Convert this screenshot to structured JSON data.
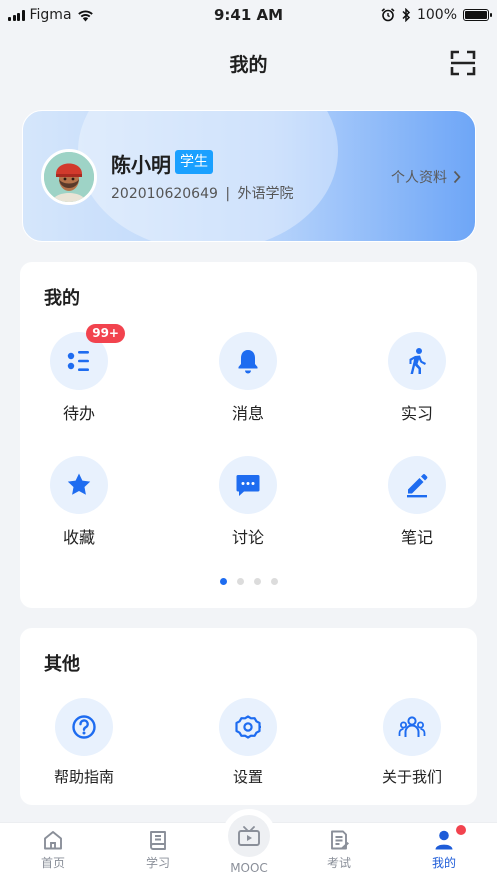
{
  "status_bar": {
    "carrier": "Figma",
    "time": "9:41 AM",
    "battery": "100%",
    "battery_level": 1.0
  },
  "nav": {
    "title": "我的"
  },
  "profile": {
    "name": "陈小明",
    "role": "学生",
    "student_id": "202010620649",
    "separator": "|",
    "college": "外语学院",
    "link_label": "个人资料"
  },
  "mine": {
    "title": "我的",
    "items": [
      {
        "label": "待办",
        "icon": "todo-list-icon",
        "badge": "99+"
      },
      {
        "label": "消息",
        "icon": "bell-icon"
      },
      {
        "label": "实习",
        "icon": "walking-person-icon"
      },
      {
        "label": "收藏",
        "icon": "star-icon"
      },
      {
        "label": "讨论",
        "icon": "chat-bubble-icon"
      },
      {
        "label": "笔记",
        "icon": "pencil-icon"
      }
    ],
    "page_count": 4,
    "active_page": 1
  },
  "other": {
    "title": "其他",
    "items": [
      {
        "label": "帮助指南",
        "icon": "question-circle-icon"
      },
      {
        "label": "设置",
        "icon": "gear-icon"
      },
      {
        "label": "关于我们",
        "icon": "people-icon"
      }
    ]
  },
  "tabs": [
    {
      "label": "首页",
      "icon": "home-icon"
    },
    {
      "label": "学习",
      "icon": "book-icon"
    },
    {
      "label": "MOOC",
      "icon": "tv-icon"
    },
    {
      "label": "考试",
      "icon": "exam-paper-icon"
    },
    {
      "label": "我的",
      "icon": "person-icon",
      "active": true
    }
  ],
  "colors": {
    "accent": "#1e6cf0",
    "badge_red": "#f2434e",
    "role_blue": "#1aa0ff"
  }
}
